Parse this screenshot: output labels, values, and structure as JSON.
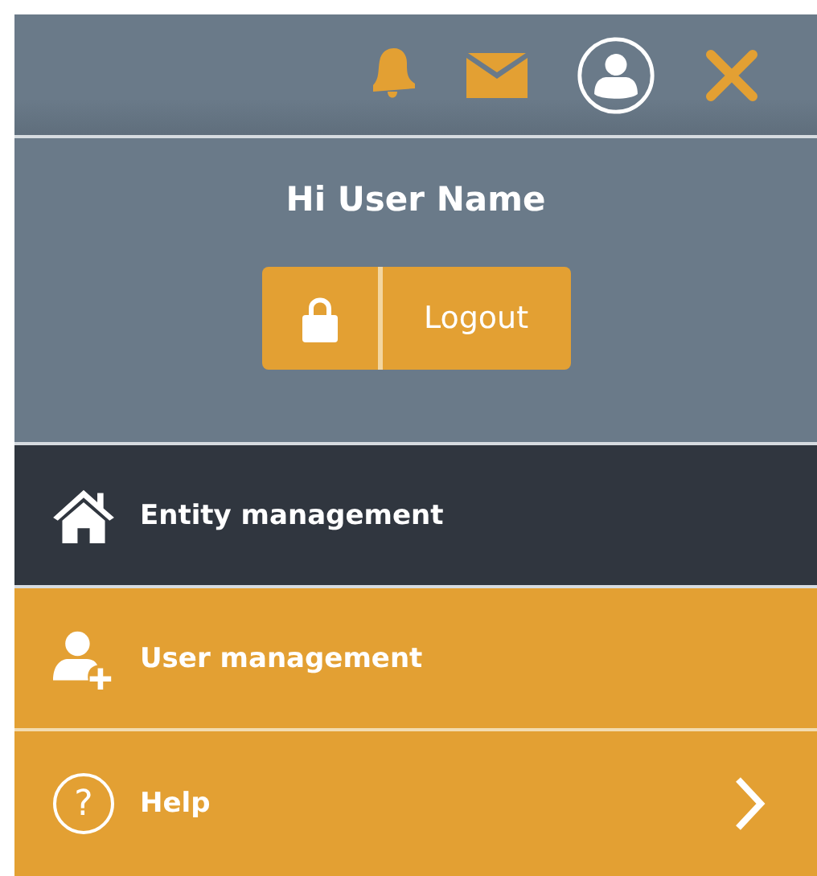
{
  "greeting": "Hi User Name",
  "logout_button": {
    "label": "Logout"
  },
  "menu": [
    {
      "kind": "home",
      "label": "Entity management",
      "selected": true,
      "submenu": false
    },
    {
      "kind": "user-add",
      "label": "User management",
      "selected": false,
      "submenu": false
    },
    {
      "kind": "help",
      "label": "Help",
      "icon": "?",
      "selected": false,
      "submenu": true
    }
  ]
}
